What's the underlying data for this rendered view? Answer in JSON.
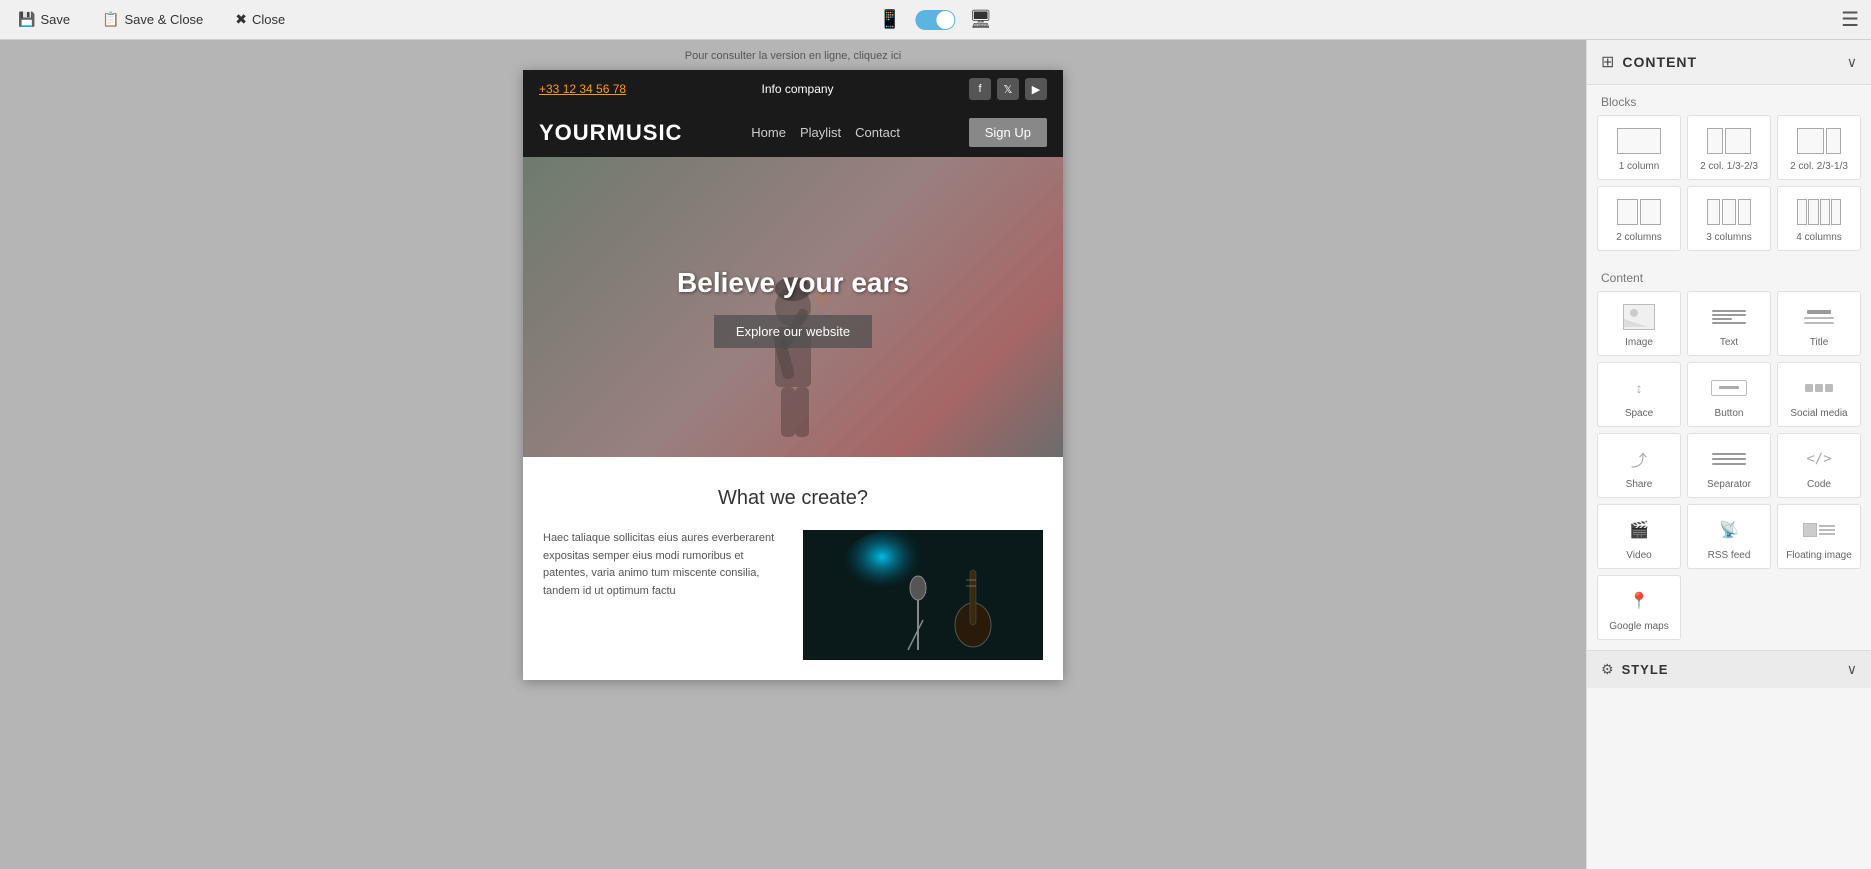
{
  "toolbar": {
    "save_label": "Save",
    "save_close_label": "Save & Close",
    "close_label": "Close"
  },
  "device_toggle": {
    "mobile_icon": "📱",
    "desktop_icon": "🖥",
    "toggle_on": true
  },
  "notice": {
    "text": "Pour consulter la version en ligne,",
    "link_text": "cliquez ici"
  },
  "site": {
    "phone": "+33 12 34 56 78",
    "company": "Info company",
    "logo": "YOURMUSIC",
    "nav_links": [
      "Home",
      "Playlist",
      "Contact"
    ],
    "signup_label": "Sign Up",
    "hero_title": "Believe your ears",
    "hero_btn": "Explore our website",
    "section_title": "What we create?",
    "body_text": "Haec taliaque sollicitas eius aures everberarent expositas semper eius modi rumoribus et patentes, varia animo tum miscente consilia, tandem id ut optimum factu"
  },
  "panel": {
    "title": "CONTENT",
    "blocks_label": "Blocks",
    "content_label": "Content",
    "blocks": [
      {
        "label": "1 column",
        "type": "1col"
      },
      {
        "label": "2 col. 1/3-2/3",
        "type": "2col-1323"
      },
      {
        "label": "2 col. 2/3-1/3",
        "type": "2col-2313"
      },
      {
        "label": "2 columns",
        "type": "2col"
      },
      {
        "label": "3 columns",
        "type": "3col"
      },
      {
        "label": "4 columns",
        "type": "4col"
      }
    ],
    "content_blocks": [
      {
        "label": "Image",
        "type": "image"
      },
      {
        "label": "Text",
        "type": "text"
      },
      {
        "label": "Title",
        "type": "title"
      },
      {
        "label": "Space",
        "type": "space"
      },
      {
        "label": "Button",
        "type": "button"
      },
      {
        "label": "Social media",
        "type": "social"
      },
      {
        "label": "Share",
        "type": "share"
      },
      {
        "label": "Separator",
        "type": "separator"
      },
      {
        "label": "Code",
        "type": "code"
      },
      {
        "label": "Video",
        "type": "video"
      },
      {
        "label": "RSS feed",
        "type": "rss"
      },
      {
        "label": "Floating image",
        "type": "floating"
      },
      {
        "label": "Google maps",
        "type": "maps"
      }
    ],
    "style_label": "STYLE"
  }
}
